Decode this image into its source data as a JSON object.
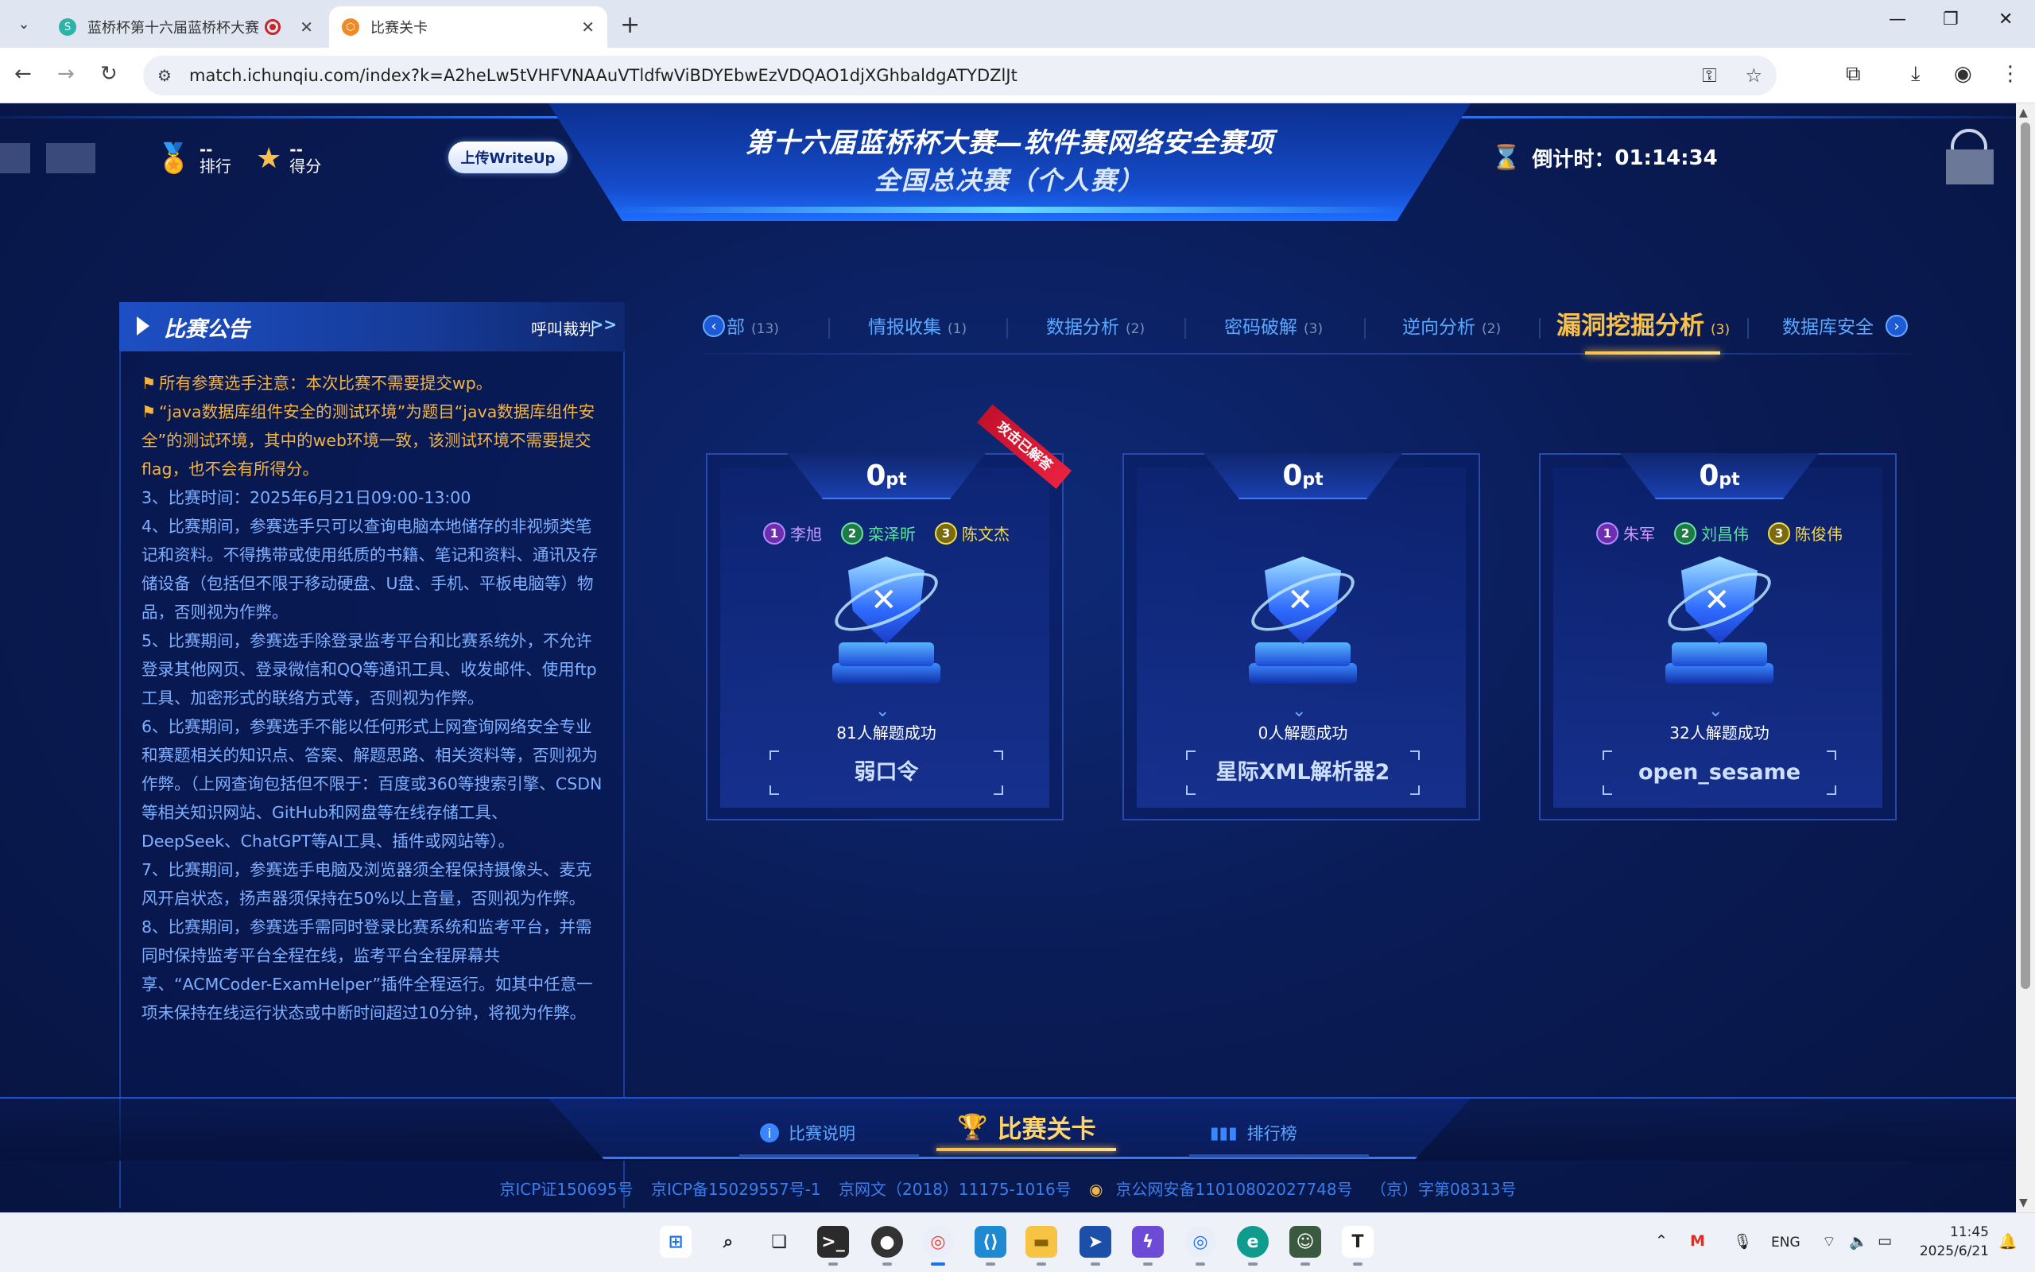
{
  "browser": {
    "tabs": [
      {
        "title": "蓝桥杯第十六届蓝桥杯大赛",
        "active": false,
        "recording": true
      },
      {
        "title": "比赛关卡",
        "active": true,
        "recording": false
      }
    ],
    "url": "match.ichunqiu.com/index?k=A2heLw5tVHFVNAAuVTldfwViBDYEbwEzVDQAO1djXGhbaldgATYDZlJt"
  },
  "header": {
    "title_line1": "第十六届蓝桥杯大赛—软件赛网络安全赛项",
    "title_line2": "全国总决赛（个人赛）",
    "rank_value": "--",
    "rank_label": "排行",
    "score_value": "--",
    "score_label": "得分",
    "upload_label": "上传WriteUp",
    "countdown_label": "倒计时：",
    "countdown_value": "01:14:34"
  },
  "notice": {
    "title": "比赛公告",
    "call_referee": "呼叫裁判",
    "call_arrow": ">>",
    "warn1": "所有参赛选手注意：本次比赛不需要提交wp。",
    "warn2": "“java数据库组件安全的测试环境”为题目“java数据库组件安全”的测试环境，其中的web环境一致，该测试环境不需要提交flag，也不会有所得分。",
    "items": [
      "3、比赛时间：2025年6月21日09:00-13:00",
      "4、比赛期间，参赛选手只可以查询电脑本地储存的非视频类笔记和资料。不得携带或使用纸质的书籍、笔记和资料、通讯及存储设备（包括但不限于移动硬盘、U盘、手机、平板电脑等）物品，否则视为作弊。",
      "5、比赛期间，参赛选手除登录监考平台和比赛系统外，不允许登录其他网页、登录微信和QQ等通讯工具、收发邮件、使用ftp工具、加密形式的联络方式等，否则视为作弊。",
      "6、比赛期间，参赛选手不能以任何形式上网查询网络安全专业和赛题相关的知识点、答案、解题思路、相关资料等，否则视为作弊。（上网查询包括但不限于：百度或360等搜索引擎、CSDN等相关知识网站、GitHub和网盘等在线存储工具、DeepSeek、ChatGPT等AI工具、插件或网站等）。",
      "7、比赛期间，参赛选手电脑及浏览器须全程保持摄像头、麦克风开启状态，扬声器须保持在50%以上音量，否则视为作弊。",
      "8、比赛期间，参赛选手需同时登录比赛系统和监考平台，并需同时保持监考平台全程在线，监考平台全程屏幕共享、“ACMCoder-ExamHelper”插件全程运行。如其中任意一项未保持在线运行状态或中断时间超过10分钟，将视为作弊。"
    ]
  },
  "categories": [
    {
      "label": "部",
      "count": "(13)"
    },
    {
      "label": "情报收集",
      "count": "(1)"
    },
    {
      "label": "数据分析",
      "count": "(2)"
    },
    {
      "label": "密码破解",
      "count": "(3)"
    },
    {
      "label": "逆向分析",
      "count": "(2)"
    },
    {
      "label": "漏洞挖掘分析",
      "count": "(3)",
      "active": true
    },
    {
      "label": "数据库安全",
      "count": ""
    }
  ],
  "challenges": [
    {
      "points": "0",
      "unit": "pt",
      "ribbon": "攻击已解答",
      "solvers": [
        {
          "rank": "1",
          "name": "李旭"
        },
        {
          "rank": "2",
          "name": "栾泽昕"
        },
        {
          "rank": "3",
          "name": "陈文杰"
        }
      ],
      "solved": "81人解题成功",
      "name": "弱口令"
    },
    {
      "points": "0",
      "unit": "pt",
      "ribbon": "",
      "solvers": [],
      "solved": "0人解题成功",
      "name": "星际XML解析器2"
    },
    {
      "points": "0",
      "unit": "pt",
      "ribbon": "",
      "solvers": [
        {
          "rank": "1",
          "name": "朱军"
        },
        {
          "rank": "2",
          "name": "刘昌伟"
        },
        {
          "rank": "3",
          "name": "陈俊伟"
        }
      ],
      "solved": "32人解题成功",
      "name": "open_sesame"
    }
  ],
  "bottom_nav": [
    {
      "label": "比赛说明"
    },
    {
      "label": "比赛关卡",
      "active": true
    },
    {
      "label": "排行榜"
    }
  ],
  "footer": {
    "icp1": "京ICP证150695号",
    "icp2": "京ICP备15029557号-1",
    "wenhua": "京网文（2018）11175-1016号",
    "police": "京公网安备11010802027748号",
    "zi": "（京）字第08313号"
  },
  "taskbar": {
    "lang": "ENG",
    "time": "11:45",
    "date": "2025/6/21"
  },
  "colors": {
    "accent_gold": "#f7c04a",
    "link_blue": "#5aa7ff",
    "warn_orange": "#f2b445",
    "bg_navy": "#0b1a4a"
  }
}
